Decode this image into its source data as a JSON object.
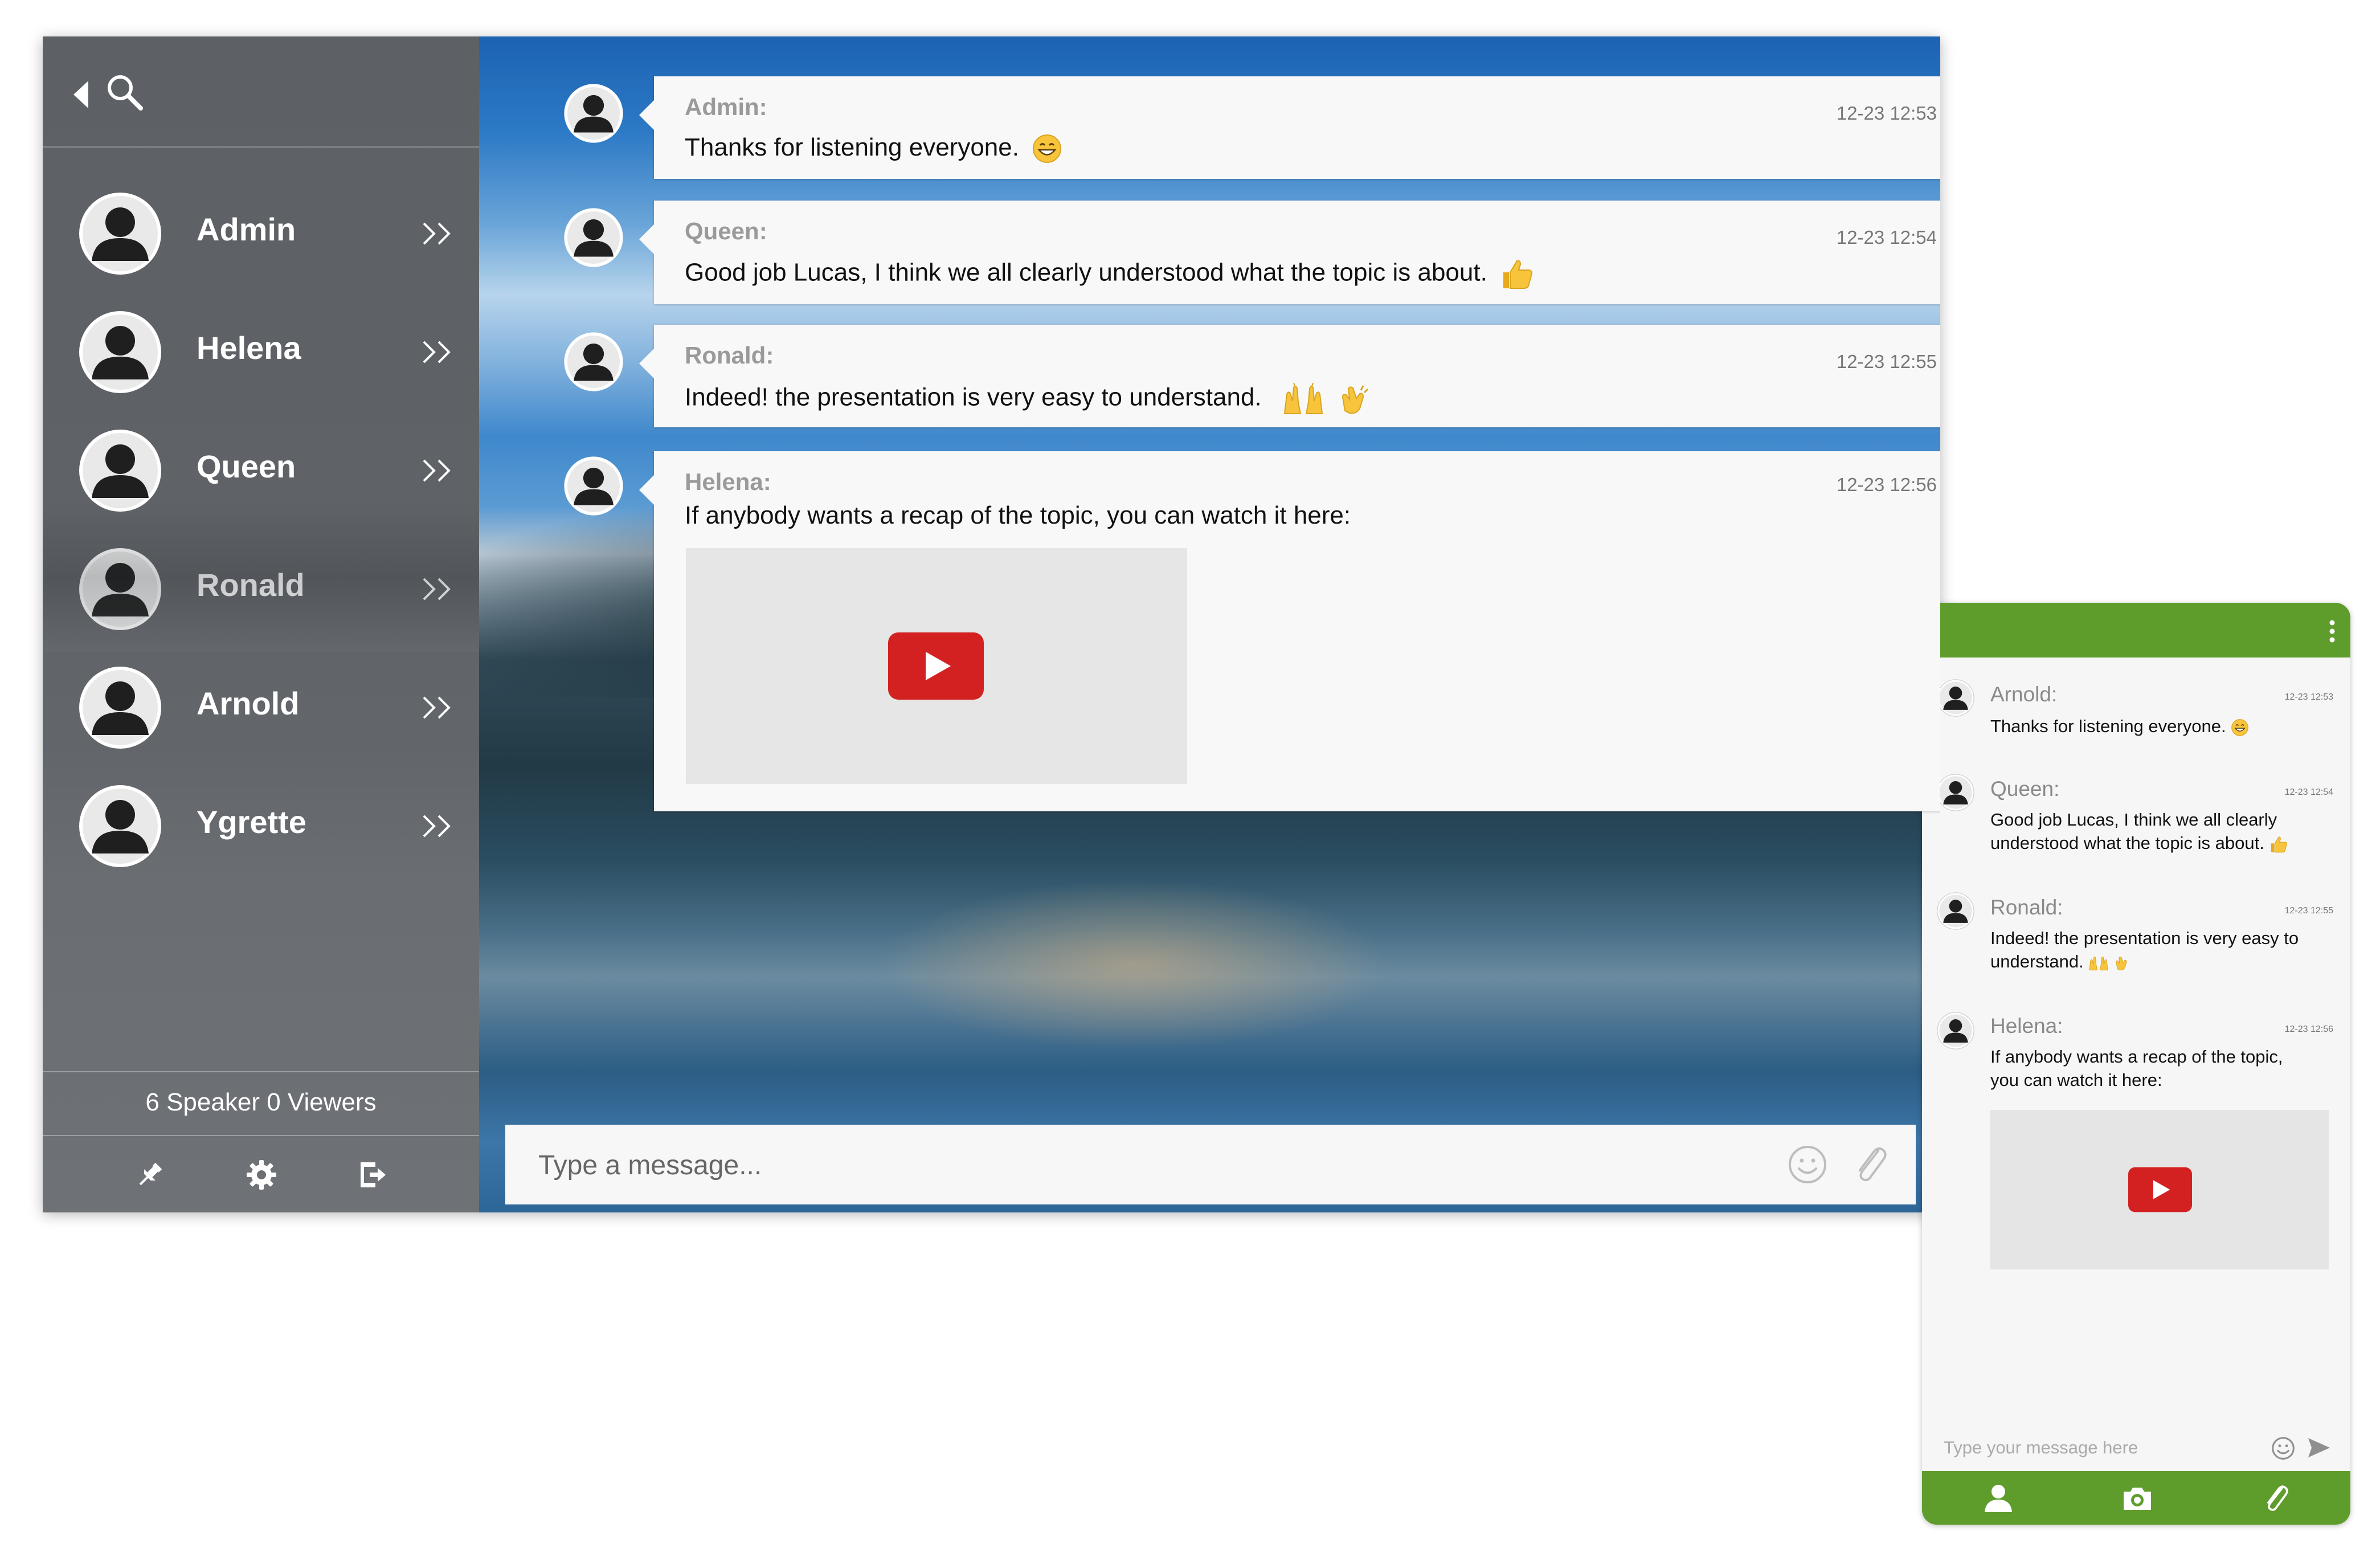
{
  "colors": {
    "sidebar": "#5f6367",
    "mobile_accent": "#5e9d2b",
    "play_red": "#d32121"
  },
  "sidebar": {
    "back_icon": "chevron-left-icon",
    "search_icon": "search-icon",
    "contacts": [
      {
        "name": "Admin"
      },
      {
        "name": "Helena"
      },
      {
        "name": "Queen"
      },
      {
        "name": "Ronald"
      },
      {
        "name": "Arnold"
      },
      {
        "name": "Ygrette"
      }
    ],
    "status": "6 Speaker 0 Viewers",
    "actions": [
      "pin-icon",
      "gear-icon",
      "logout-icon"
    ]
  },
  "chat": {
    "messages": [
      {
        "author": "Admin:",
        "time": "12-23 12:53",
        "text": "Thanks for listening everyone.",
        "emoji": [
          "grin-emoji"
        ]
      },
      {
        "author": "Queen:",
        "time": "12-23 12:54",
        "text": "Good job Lucas, I think we all clearly understood what the topic is about.",
        "emoji": [
          "thumbs-up-emoji"
        ]
      },
      {
        "author": "Ronald:",
        "time": "12-23 12:55",
        "text": "Indeed! the presentation is very easy to understand.",
        "emoji": [
          "raising-hands-emoji",
          "clapping-emoji"
        ]
      },
      {
        "author": "Helena:",
        "time": "12-23 12:56",
        "text": "If anybody wants a recap of the topic, you can watch it here:",
        "emoji": []
      }
    ],
    "input_placeholder": "Type a message..."
  },
  "mobile": {
    "messages": [
      {
        "author": "Arnold:",
        "time": "12-23 12:53",
        "line1": "Thanks for listening everyone.",
        "line2": ""
      },
      {
        "author": "Queen:",
        "time": "12-23 12:54",
        "line1": "Good job Lucas, I think we all clearly",
        "line2": "understood what the topic is about."
      },
      {
        "author": "Ronald:",
        "time": "12-23 12:55",
        "line1": "Indeed! the presentation is very easy to",
        "line2": "understand."
      },
      {
        "author": "Helena:",
        "time": "12-23 12:56",
        "line1": "If anybody wants a recap of the topic,",
        "line2": "you can watch it here:"
      }
    ],
    "input_placeholder": "Type your message here",
    "footer_icons": [
      "user-icon",
      "camera-icon",
      "paperclip-icon"
    ]
  }
}
